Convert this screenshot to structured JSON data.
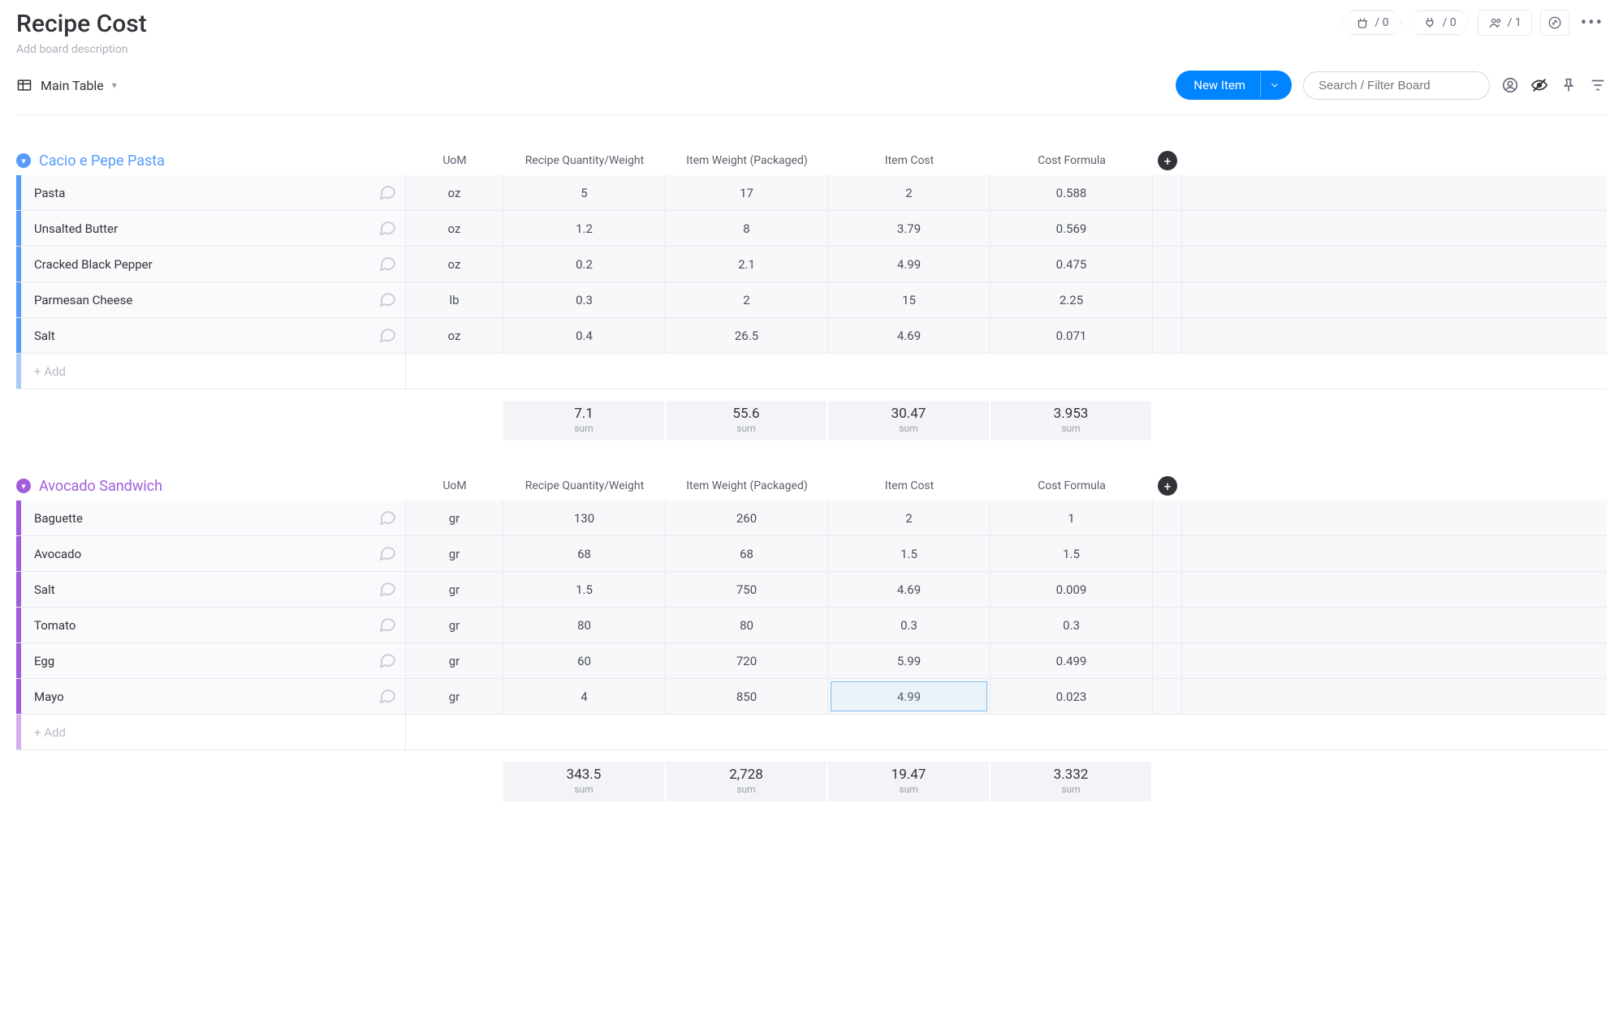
{
  "header": {
    "title": "Recipe Cost",
    "description_placeholder": "Add board description",
    "automations_count": "/ 0",
    "integrations_count": "/ 0",
    "members_count": "/ 1"
  },
  "toolbar": {
    "view_label": "Main Table",
    "new_item_label": "New Item",
    "search_placeholder": "Search / Filter Board"
  },
  "columns": {
    "uom": "UoM",
    "qty": "Recipe Quantity/Weight",
    "pkg": "Item Weight (Packaged)",
    "cost": "Item Cost",
    "formula": "Cost Formula"
  },
  "add_row_label": "+ Add",
  "sum_label": "sum",
  "groups": [
    {
      "name": "Cacio e Pepe Pasta",
      "color": "blue",
      "rows": [
        {
          "name": "Pasta",
          "uom": "oz",
          "qty": "5",
          "pkg": "17",
          "cost": "2",
          "formula": "0.588"
        },
        {
          "name": "Unsalted Butter",
          "uom": "oz",
          "qty": "1.2",
          "pkg": "8",
          "cost": "3.79",
          "formula": "0.569"
        },
        {
          "name": "Cracked Black Pepper",
          "uom": "oz",
          "qty": "0.2",
          "pkg": "2.1",
          "cost": "4.99",
          "formula": "0.475"
        },
        {
          "name": "Parmesan Cheese",
          "uom": "lb",
          "qty": "0.3",
          "pkg": "2",
          "cost": "15",
          "formula": "2.25"
        },
        {
          "name": "Salt",
          "uom": "oz",
          "qty": "0.4",
          "pkg": "26.5",
          "cost": "4.69",
          "formula": "0.071"
        }
      ],
      "sums": {
        "qty": "7.1",
        "pkg": "55.6",
        "cost": "30.47",
        "formula": "3.953"
      }
    },
    {
      "name": "Avocado Sandwich",
      "color": "purple",
      "rows": [
        {
          "name": "Baguette",
          "uom": "gr",
          "qty": "130",
          "pkg": "260",
          "cost": "2",
          "formula": "1"
        },
        {
          "name": "Avocado",
          "uom": "gr",
          "qty": "68",
          "pkg": "68",
          "cost": "1.5",
          "formula": "1.5"
        },
        {
          "name": "Salt",
          "uom": "gr",
          "qty": "1.5",
          "pkg": "750",
          "cost": "4.69",
          "formula": "0.009"
        },
        {
          "name": "Tomato",
          "uom": "gr",
          "qty": "80",
          "pkg": "80",
          "cost": "0.3",
          "formula": "0.3"
        },
        {
          "name": "Egg",
          "uom": "gr",
          "qty": "60",
          "pkg": "720",
          "cost": "5.99",
          "formula": "0.499"
        },
        {
          "name": "Mayo",
          "uom": "gr",
          "qty": "4",
          "pkg": "850",
          "cost": "4.99",
          "formula": "0.023",
          "selected_col": "cost"
        }
      ],
      "sums": {
        "qty": "343.5",
        "pkg": "2,728",
        "cost": "19.47",
        "formula": "3.332"
      }
    }
  ]
}
